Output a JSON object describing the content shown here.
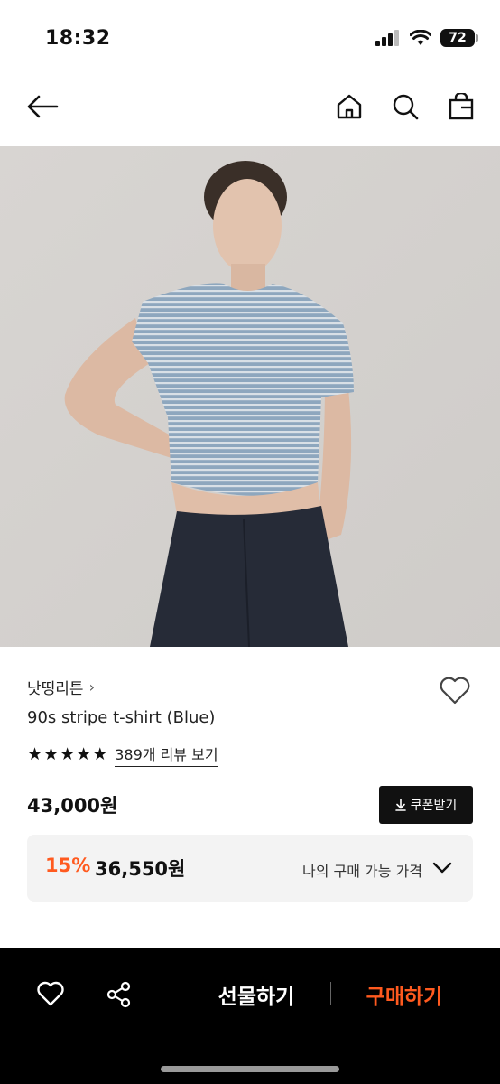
{
  "status_bar": {
    "time": "18:32",
    "battery": "72"
  },
  "header": {
    "back_icon": "arrow-left-icon",
    "home_icon": "home-icon",
    "search_icon": "search-icon",
    "bag_icon": "shopping-bag-icon"
  },
  "product": {
    "brand": "낫띵리튼",
    "brand_chevron": "›",
    "name": "90s stripe t-shirt (Blue)",
    "rating_stars": 5,
    "review_link": "389개 리뷰 보기",
    "price": "43,000원",
    "coupon_label": "쿠폰받기",
    "discount_rate": "15%",
    "discount_price": "36,550원",
    "my_price_label": "나의 구매 가능 가격"
  },
  "bottom_bar": {
    "gift_label": "선물하기",
    "buy_label": "구매하기"
  },
  "colors": {
    "accent": "#ff5a1f",
    "dark": "#111111",
    "panel": "#f3f3f3"
  }
}
